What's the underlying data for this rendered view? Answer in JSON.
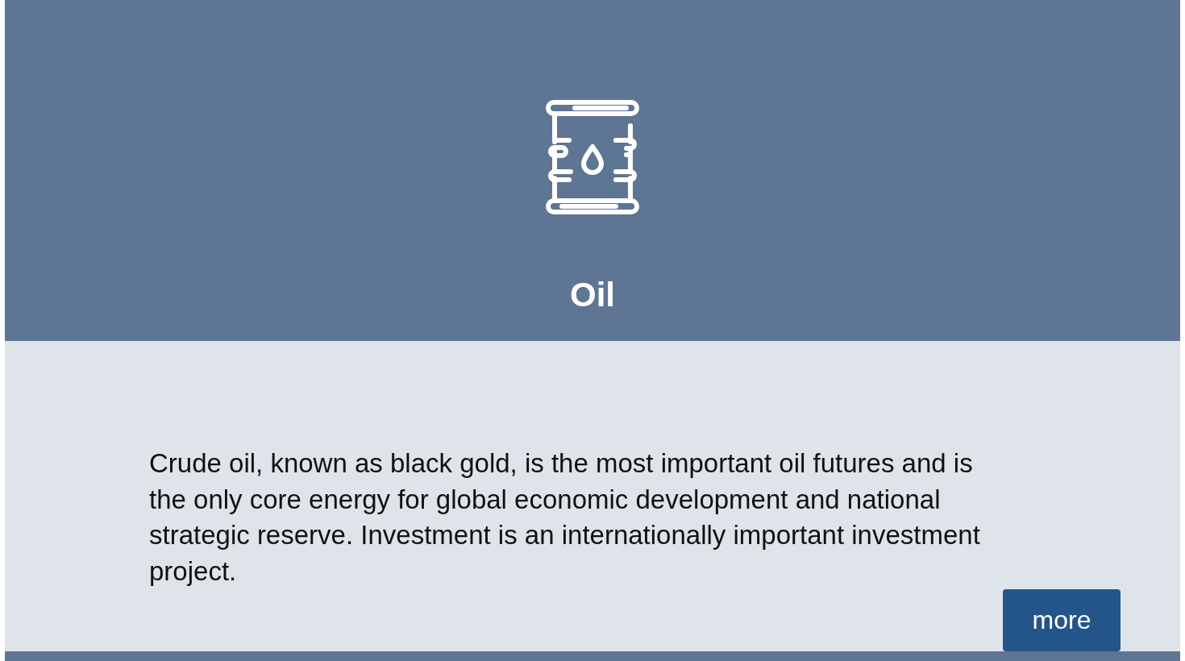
{
  "card": {
    "title": "Oil",
    "description": "Crude oil, known as black gold, is the most important oil futures and is the only core energy for global economic development and national strategic reserve. Investment is an internationally important investment project.",
    "button": "more"
  }
}
